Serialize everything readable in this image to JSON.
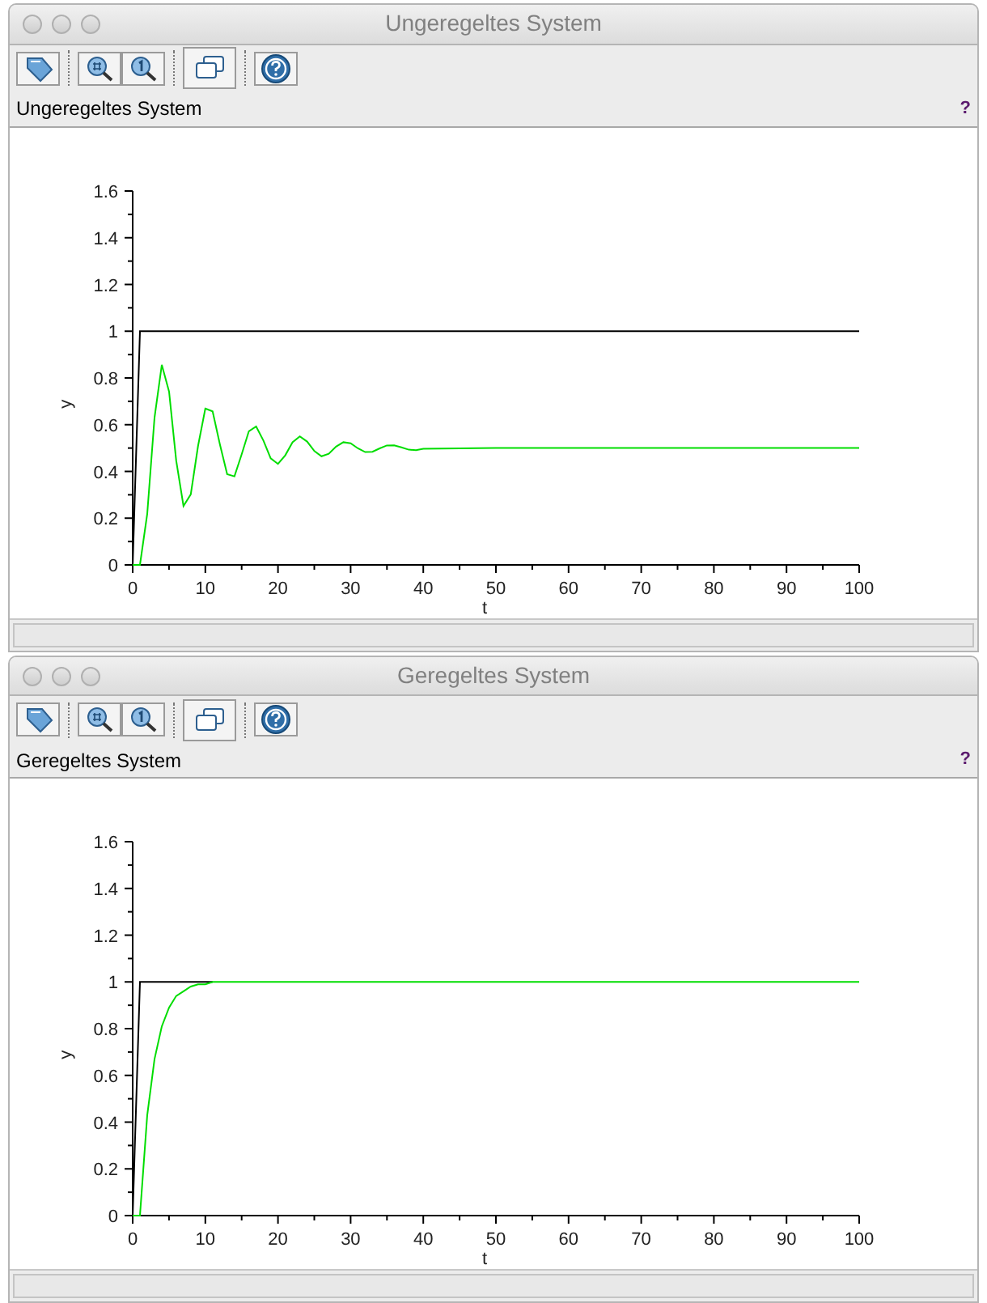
{
  "windows": [
    {
      "title": "Ungeregeltes System",
      "label": "Ungeregeltes System",
      "help_mark": "?",
      "chart_data": {
        "type": "line",
        "xlabel": "t",
        "ylabel": "y",
        "xlim": [
          0,
          100
        ],
        "ylim": [
          0,
          1.6
        ],
        "xticks": [
          0,
          10,
          20,
          30,
          40,
          50,
          60,
          70,
          80,
          90,
          100
        ],
        "yticks": [
          0,
          0.2,
          0.4,
          0.6,
          0.8,
          1,
          1.2,
          1.4,
          1.6
        ],
        "x": [
          0,
          1,
          2,
          3,
          4,
          5,
          6,
          7,
          8,
          9,
          10,
          11,
          12,
          13,
          14,
          15,
          16,
          17,
          18,
          19,
          20,
          21,
          22,
          23,
          24,
          25,
          26,
          27,
          28,
          29,
          30,
          31,
          32,
          33,
          34,
          35,
          36,
          37,
          38,
          39,
          40,
          50,
          60,
          70,
          80,
          90,
          100
        ],
        "series": [
          {
            "color": "#000000",
            "values": [
              0,
              1,
              1,
              1,
              1,
              1,
              1,
              1,
              1,
              1,
              1,
              1,
              1,
              1,
              1,
              1,
              1,
              1,
              1,
              1,
              1,
              1,
              1,
              1,
              1,
              1,
              1,
              1,
              1,
              1,
              1,
              1,
              1,
              1,
              1,
              1,
              1,
              1,
              1,
              1,
              1,
              1,
              1,
              1,
              1,
              1,
              1
            ]
          },
          {
            "color": "#00dd00",
            "values": [
              0,
              0,
              0.218,
              0.63,
              0.856,
              0.741,
              0.446,
              0.252,
              0.302,
              0.509,
              0.669,
              0.657,
              0.516,
              0.388,
              0.379,
              0.472,
              0.572,
              0.592,
              0.532,
              0.456,
              0.432,
              0.469,
              0.525,
              0.55,
              0.528,
              0.487,
              0.465,
              0.476,
              0.506,
              0.525,
              0.52,
              0.499,
              0.483,
              0.484,
              0.499,
              0.511,
              0.512,
              0.503,
              0.493,
              0.491,
              0.497,
              0.5,
              0.5,
              0.5,
              0.5,
              0.5,
              0.5
            ]
          }
        ]
      }
    },
    {
      "title": "Geregeltes System",
      "label": "Geregeltes System",
      "help_mark": "?",
      "chart_data": {
        "type": "line",
        "xlabel": "t",
        "ylabel": "y",
        "xlim": [
          0,
          100
        ],
        "ylim": [
          0,
          1.6
        ],
        "xticks": [
          0,
          10,
          20,
          30,
          40,
          50,
          60,
          70,
          80,
          90,
          100
        ],
        "yticks": [
          0,
          0.2,
          0.4,
          0.6,
          0.8,
          1,
          1.2,
          1.4,
          1.6
        ],
        "x": [
          0,
          1,
          2,
          3,
          4,
          5,
          6,
          7,
          8,
          9,
          10,
          11,
          12,
          13,
          14,
          15,
          16,
          17,
          18,
          19,
          20,
          21,
          22,
          23,
          24,
          25,
          26,
          27,
          28,
          29,
          30,
          31,
          32,
          33,
          34,
          35,
          36,
          37,
          38,
          39,
          40,
          50,
          60,
          70,
          80,
          90,
          100
        ],
        "series": [
          {
            "color": "#000000",
            "values": [
              0,
              1,
              1,
              1,
              1,
              1,
              1,
              1,
              1,
              1,
              1,
              1,
              null,
              null,
              null,
              null,
              null,
              null,
              null,
              null,
              null,
              null,
              null,
              null,
              null,
              null,
              null,
              null,
              null,
              null,
              null,
              null,
              null,
              null,
              null,
              null,
              null,
              null,
              null,
              null,
              null,
              null,
              null,
              null,
              null,
              null,
              null
            ]
          },
          {
            "color": "#00dd00",
            "values": [
              0,
              0,
              0.43,
              0.67,
              0.81,
              0.89,
              0.94,
              0.96,
              0.98,
              0.99,
              0.99,
              1,
              1,
              1,
              1,
              1,
              1,
              1,
              1,
              1,
              1,
              1,
              1,
              1,
              1,
              1,
              1,
              1,
              1,
              1,
              1,
              1,
              1,
              1,
              1,
              1,
              1,
              1,
              1,
              1,
              1,
              1,
              1,
              1,
              1,
              1,
              1
            ]
          }
        ]
      }
    }
  ]
}
